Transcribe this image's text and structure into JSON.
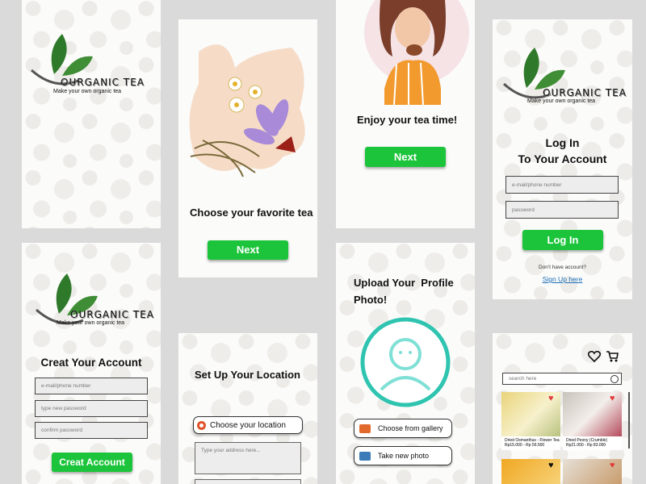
{
  "brand": {
    "name": "OURGANIC TEA",
    "tagline": "Make your own organic tea"
  },
  "onboarding1": {
    "heading": "Choose your favorite tea",
    "next_label": "Next"
  },
  "onboarding2": {
    "heading": "Enjoy your tea time!",
    "next_label": "Next"
  },
  "login": {
    "title_line1": "Log In",
    "title_line2": "To Your Account",
    "email_placeholder": "e-mail/phone number",
    "password_placeholder": "password",
    "login_label": "Log In",
    "no_account_text": "Don't have account?",
    "signup_link": "Sign Up here"
  },
  "register": {
    "title": "Creat Your Account",
    "email_placeholder": "e-mail/phone number",
    "new_password_placeholder": "type new password",
    "confirm_password_placeholder": "confirm password",
    "create_label": "Creat Account"
  },
  "location": {
    "title": "Set Up Your Location",
    "choose_label": "Choose your location",
    "address_placeholder": "Type your address here..."
  },
  "upload": {
    "title_line1": "Upload Your  Profile",
    "title_line2": "Photo!",
    "gallery_label": "Choose from gallery",
    "camera_label": "Take new photo"
  },
  "shop": {
    "search_placeholder": "search here",
    "products": [
      {
        "name": "Dried Osmanthus - Flower Tea",
        "price": "Rp15.000 - Rp 56.500"
      },
      {
        "name": "Dried Peony (Crumble)",
        "price": "Rp21.000 - Rp 83.000"
      }
    ]
  },
  "colors": {
    "accent": "#1bc43a",
    "link": "#1a6fb8",
    "avatar_ring": "#2ec4b0"
  }
}
